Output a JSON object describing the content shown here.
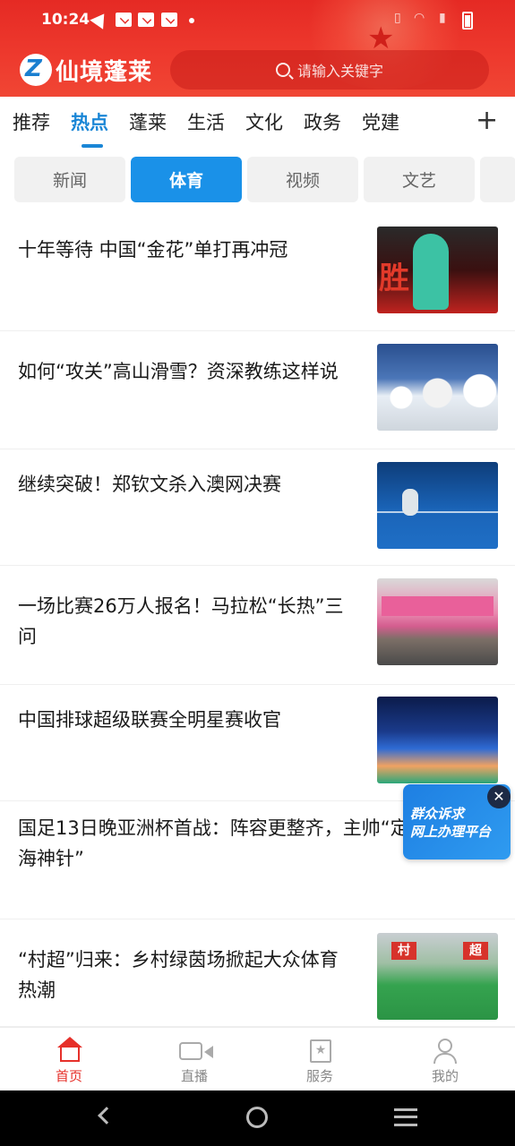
{
  "status_bar": {
    "time": "10:24"
  },
  "header": {
    "logo_text": "仙境蓬莱",
    "logo_mark": "Z",
    "search_placeholder": "请输入关键字"
  },
  "category_tabs": [
    "推荐",
    "热点",
    "蓬莱",
    "生活",
    "文化",
    "政务",
    "党建"
  ],
  "category_active": "热点",
  "sub_tabs": [
    "新闻",
    "体育",
    "视频",
    "文艺"
  ],
  "sub_active": "体育",
  "news": [
    {
      "title": "十年等待  中国“金花”单打再冲冠",
      "thumb_text": "胜利"
    },
    {
      "title": "如何“攻关”高山滑雪？资深教练这样说"
    },
    {
      "title": "继续突破！郑钦文杀入澳网决赛"
    },
    {
      "title": "一场比赛26万人报名！马拉松“长热”三问"
    },
    {
      "title": "中国排球超级联赛全明星赛收官"
    },
    {
      "title": "国足13日晚亚洲杯首战：阵容更整齐，主帅“定海神针”"
    },
    {
      "title": "“村超”归来：乡村绿茵场掀起大众体育热潮",
      "thumb_text": [
        "村",
        "超"
      ]
    }
  ],
  "float_card": {
    "line1": "群众诉求",
    "line2": "网上办理平台",
    "close": "✕"
  },
  "bottom_nav": [
    {
      "label": "首页",
      "icon": "home-icon"
    },
    {
      "label": "直播",
      "icon": "video-camera-icon"
    },
    {
      "label": "服务",
      "icon": "star-bookmark-icon"
    },
    {
      "label": "我的",
      "icon": "person-icon"
    }
  ],
  "colors": {
    "header_red": "#e52a24",
    "accent_blue": "#1a86d6",
    "nav_active_red": "#e6302a"
  }
}
